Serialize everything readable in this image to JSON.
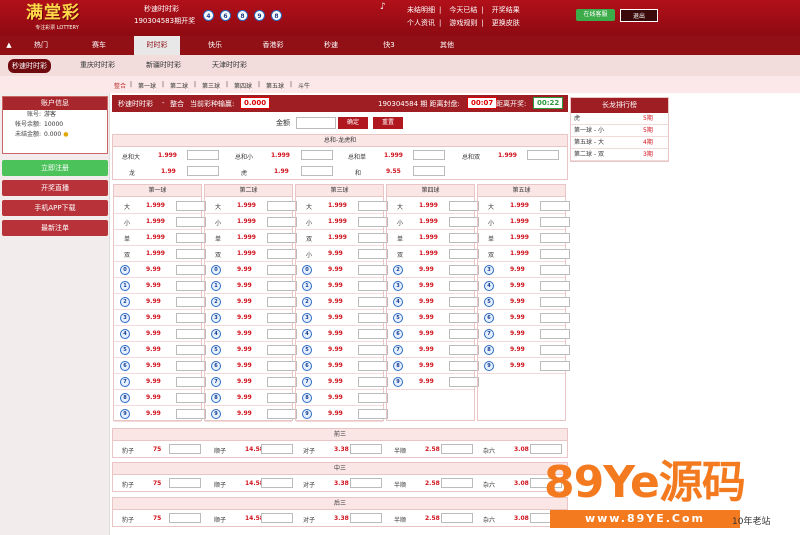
{
  "header": {
    "logo_text": "满堂彩",
    "logo_sub": "专注彩票 LOTTERY",
    "game_name": "秒速时时彩",
    "issue_text": "190304583期开奖",
    "balls": [
      "4",
      "6",
      "8",
      "9",
      "8"
    ],
    "links": [
      "未结明细",
      "今天已结",
      "开奖结果",
      "个人资讯",
      "游戏规则",
      "更换皮肤"
    ],
    "service": "在线客服",
    "logout": "退出"
  },
  "nav": {
    "items": [
      "热门",
      "赛车",
      "时时彩",
      "快乐",
      "香港彩",
      "秒速",
      "快3",
      "其他"
    ],
    "active": 2
  },
  "subnav": {
    "items": [
      "秒速时时彩",
      "重庆时时彩",
      "新疆时时彩",
      "天津时时彩"
    ]
  },
  "subtabs": {
    "items": [
      "整合",
      "第一球",
      "第二球",
      "第三球",
      "第四球",
      "第五球",
      "斗牛"
    ]
  },
  "account": {
    "title": "账户信息",
    "rows": [
      {
        "k": "账号:",
        "v": "游客"
      },
      {
        "k": "帐号余额:",
        "v": "10000"
      },
      {
        "k": "未结金额:",
        "v": "0.000"
      }
    ]
  },
  "side_buttons": [
    "立即注册",
    "开奖直播",
    "手机APP下载",
    "最新注单"
  ],
  "bar": {
    "game": "秒速时时彩",
    "sep": "-",
    "play": "整合",
    "win_label": "当前彩种输赢:",
    "win_value": "0.000",
    "issue": "190304584 期 距离封盘:",
    "close_time": "00:07",
    "open_label": "距离开奖:",
    "open_time": "00:22"
  },
  "amount": {
    "label": "金额",
    "confirm": "确定",
    "reset": "重置"
  },
  "total": {
    "title": "总和-龙虎和",
    "row1": [
      {
        "k": "总和大",
        "o": "1.999"
      },
      {
        "k": "总和小",
        "o": "1.999"
      },
      {
        "k": "总和单",
        "o": "1.999"
      },
      {
        "k": "总和双",
        "o": "1.999"
      }
    ],
    "row2": [
      {
        "k": "龙",
        "o": "1.99"
      },
      {
        "k": "虎",
        "o": "1.99"
      },
      {
        "k": "和",
        "o": "9.55"
      }
    ]
  },
  "balls": {
    "headers": [
      "第一球",
      "第二球",
      "第三球",
      "第四球",
      "第五球"
    ],
    "attr_rows": [
      {
        "k": "大",
        "o": "1.999"
      },
      {
        "k": "小",
        "o": "1.999"
      },
      {
        "k": "单",
        "o": "1.999"
      },
      {
        "k": "双",
        "o": "1.999"
      }
    ],
    "num_odds": "9.99",
    "nums": [
      "0",
      "1",
      "2",
      "3",
      "4",
      "5",
      "6",
      "7",
      "8",
      "9"
    ]
  },
  "groups": [
    {
      "title": "前三",
      "items": [
        {
          "k": "豹子",
          "o": "75"
        },
        {
          "k": "顺子",
          "o": "14.58"
        },
        {
          "k": "对子",
          "o": "3.38"
        },
        {
          "k": "半顺",
          "o": "2.58"
        },
        {
          "k": "杂六",
          "o": "3.08"
        }
      ]
    },
    {
      "title": "中三",
      "items": [
        {
          "k": "豹子",
          "o": "75"
        },
        {
          "k": "顺子",
          "o": "14.58"
        },
        {
          "k": "对子",
          "o": "3.38"
        },
        {
          "k": "半顺",
          "o": "2.58"
        },
        {
          "k": "杂六",
          "o": "3.08"
        }
      ]
    },
    {
      "title": "后三",
      "items": [
        {
          "k": "豹子",
          "o": "75"
        },
        {
          "k": "顺子",
          "o": "14.58"
        },
        {
          "k": "对子",
          "o": "3.38"
        },
        {
          "k": "半顺",
          "o": "2.58"
        },
        {
          "k": "杂六",
          "o": "3.08"
        }
      ]
    }
  ],
  "dragon": {
    "title": "长龙排行榜",
    "rows": [
      {
        "a": "虎",
        "b": "5期"
      },
      {
        "a": "第一球 - 小",
        "b": "5期"
      },
      {
        "a": "第五球 - 大",
        "b": "4期"
      },
      {
        "a": "第二球 - 双",
        "b": "3期"
      }
    ]
  },
  "watermark": {
    "big": "89Ye源码",
    "url": "www.89YE.Com",
    "old": "10年老站"
  },
  "colors": {
    "brand": "#9e1e24",
    "odds": "#d0121c",
    "green": "#3cab4a",
    "watermark": "#f47a1f"
  }
}
